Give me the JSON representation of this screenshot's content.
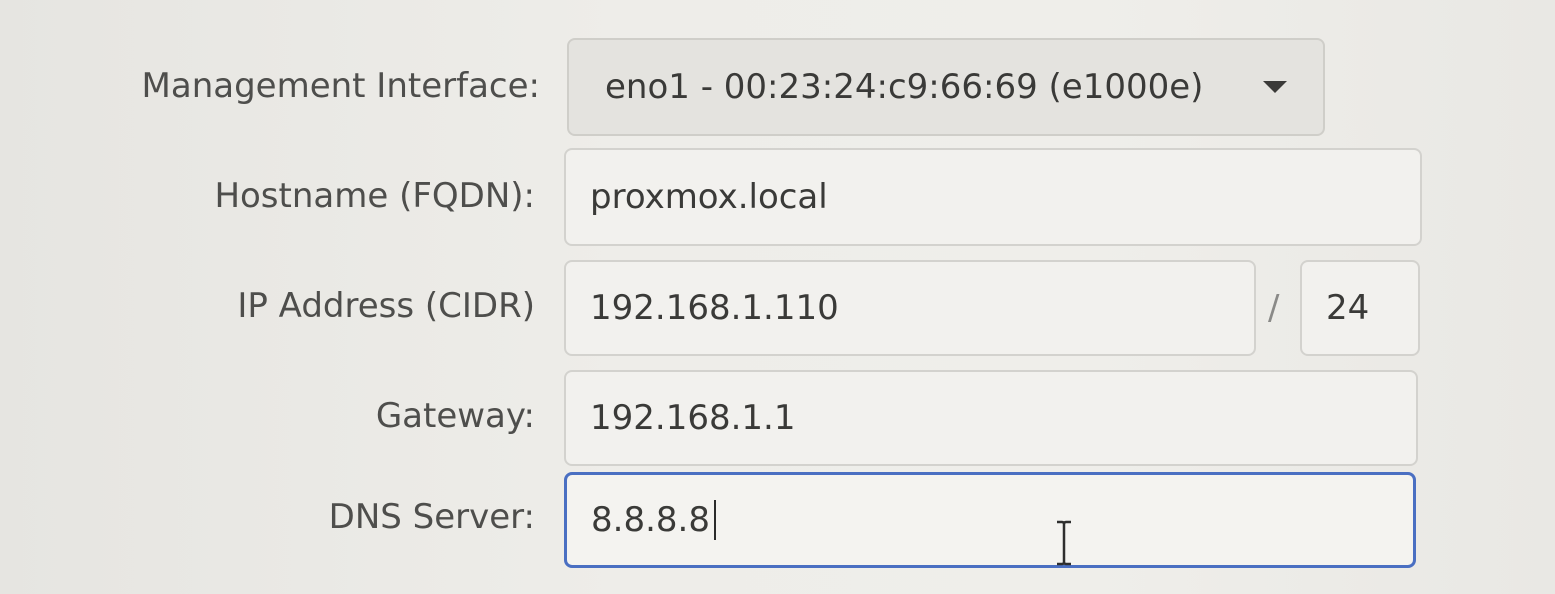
{
  "form": {
    "management_interface": {
      "label": "Management Interface:",
      "value": "eno1 - 00:23:24:c9:66:69 (e1000e)"
    },
    "hostname": {
      "label": "Hostname (FQDN):",
      "value": "proxmox.local"
    },
    "ip_address": {
      "label": "IP Address (CIDR)",
      "value": "192.168.1.110",
      "separator": "/",
      "prefix": "24"
    },
    "gateway": {
      "label": "Gateway:",
      "value": "192.168.1.1"
    },
    "dns_server": {
      "label": "DNS Server:",
      "value": "8.8.8.8"
    }
  },
  "colors": {
    "focus_border": "#4a6fc2",
    "field_background": "#f2f1ee",
    "label_text": "#4e4e4c"
  },
  "icons": {
    "dropdown": "caret-down-icon",
    "cursor": "text-cursor-icon"
  }
}
